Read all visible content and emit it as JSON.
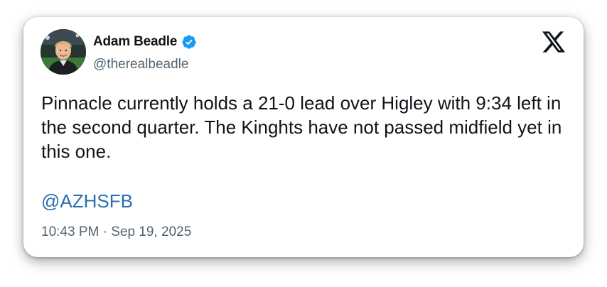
{
  "tweet": {
    "author": {
      "display_name": "Adam Beadle",
      "handle": "@therealbeadle",
      "verified": true,
      "avatar_icon": "profile-photo"
    },
    "platform_icon": "x-logo-icon",
    "text": "Pinnacle currently holds a 21-0 lead over Higley with 9:34 left in the second quarter. The Kinghts have not passed midfield yet in this one.",
    "mention": "@AZHSFB",
    "timestamp": "10:43 PM · Sep 19, 2025"
  },
  "colors": {
    "text_primary": "#0f1419",
    "text_secondary": "#536471",
    "link": "#2b6cb0",
    "verified": "#1d9bf0"
  }
}
